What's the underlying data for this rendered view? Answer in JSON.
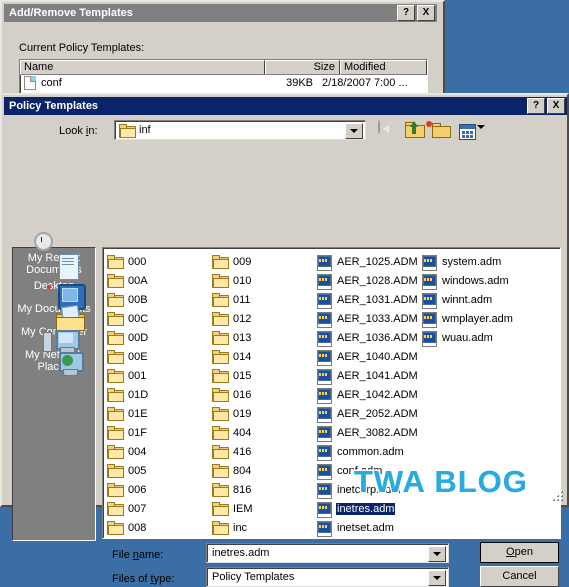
{
  "colors": {
    "desktop_bg": "#3a6ea5",
    "dialog_face": "#d4d0c8",
    "active_title": "#0a246a",
    "inactive_title": "#808080",
    "selection": "#0a246a",
    "watermark": "#29abe2"
  },
  "dialog1": {
    "title": "Add/Remove Templates",
    "help_button": "?",
    "close_button": "X",
    "label": "Current Policy Templates:",
    "columns": [
      "Name",
      "Size",
      "Modified"
    ],
    "rows": [
      {
        "name": "conf",
        "size": "39KB",
        "modified": "2/18/2007 7:00 ..."
      }
    ]
  },
  "dialog2": {
    "title": "Policy Templates",
    "help_button": "?",
    "close_button": "X",
    "lookin": {
      "label": "Look in:",
      "value": "inf"
    },
    "toolbar": [
      {
        "name": "back-icon",
        "label": "Back"
      },
      {
        "name": "up-one-level-icon",
        "label": "Up One Level"
      },
      {
        "name": "new-folder-icon",
        "label": "Create New Folder"
      },
      {
        "name": "views-icon",
        "label": "Views"
      }
    ],
    "places": [
      {
        "label": "My Recent\nDocuments",
        "line1": "My Recent",
        "line2": "Documents",
        "icon": "recent-documents-icon"
      },
      {
        "label": "Desktop",
        "line1": "Desktop",
        "line2": "",
        "icon": "desktop-icon"
      },
      {
        "label": "My Documents",
        "line1": "My Documents",
        "line2": "",
        "icon": "my-documents-icon"
      },
      {
        "label": "My Computer",
        "line1": "My Computer",
        "line2": "",
        "icon": "my-computer-icon"
      },
      {
        "label": "My Network Places",
        "line1": "My Network",
        "line2": "Places",
        "icon": "my-network-places-icon"
      }
    ],
    "file_columns": [
      {
        "items": [
          {
            "name": "000",
            "type": "folder"
          },
          {
            "name": "00A",
            "type": "folder"
          },
          {
            "name": "00B",
            "type": "folder"
          },
          {
            "name": "00C",
            "type": "folder"
          },
          {
            "name": "00D",
            "type": "folder"
          },
          {
            "name": "00E",
            "type": "folder"
          },
          {
            "name": "001",
            "type": "folder"
          },
          {
            "name": "01D",
            "type": "folder"
          },
          {
            "name": "01E",
            "type": "folder"
          },
          {
            "name": "01F",
            "type": "folder"
          },
          {
            "name": "004",
            "type": "folder"
          },
          {
            "name": "005",
            "type": "folder"
          },
          {
            "name": "006",
            "type": "folder"
          },
          {
            "name": "007",
            "type": "folder"
          },
          {
            "name": "008",
            "type": "folder"
          }
        ]
      },
      {
        "items": [
          {
            "name": "009",
            "type": "folder"
          },
          {
            "name": "010",
            "type": "folder"
          },
          {
            "name": "011",
            "type": "folder"
          },
          {
            "name": "012",
            "type": "folder"
          },
          {
            "name": "013",
            "type": "folder"
          },
          {
            "name": "014",
            "type": "folder"
          },
          {
            "name": "015",
            "type": "folder"
          },
          {
            "name": "016",
            "type": "folder"
          },
          {
            "name": "019",
            "type": "folder"
          },
          {
            "name": "404",
            "type": "folder"
          },
          {
            "name": "416",
            "type": "folder"
          },
          {
            "name": "804",
            "type": "folder"
          },
          {
            "name": "816",
            "type": "folder"
          },
          {
            "name": "IEM",
            "type": "folder"
          },
          {
            "name": "inc",
            "type": "folder"
          }
        ]
      },
      {
        "items": [
          {
            "name": "AER_1025.ADM",
            "type": "adm"
          },
          {
            "name": "AER_1028.ADM",
            "type": "adm"
          },
          {
            "name": "AER_1031.ADM",
            "type": "adm"
          },
          {
            "name": "AER_1033.ADM",
            "type": "adm"
          },
          {
            "name": "AER_1036.ADM",
            "type": "adm"
          },
          {
            "name": "AER_1040.ADM",
            "type": "adm"
          },
          {
            "name": "AER_1041.ADM",
            "type": "adm"
          },
          {
            "name": "AER_1042.ADM",
            "type": "adm"
          },
          {
            "name": "AER_2052.ADM",
            "type": "adm"
          },
          {
            "name": "AER_3082.ADM",
            "type": "adm"
          },
          {
            "name": "common.adm",
            "type": "adm"
          },
          {
            "name": "conf.adm",
            "type": "adm"
          },
          {
            "name": "inetcorp.adm",
            "type": "adm"
          },
          {
            "name": "inetres.adm",
            "type": "adm",
            "selected": true
          },
          {
            "name": "inetset.adm",
            "type": "adm"
          }
        ]
      },
      {
        "items": [
          {
            "name": "system.adm",
            "type": "adm"
          },
          {
            "name": "windows.adm",
            "type": "adm"
          },
          {
            "name": "winnt.adm",
            "type": "adm"
          },
          {
            "name": "wmplayer.adm",
            "type": "adm"
          },
          {
            "name": "wuau.adm",
            "type": "adm"
          }
        ]
      }
    ],
    "filename": {
      "label": "File name:",
      "value": "inetres.adm"
    },
    "filetype": {
      "label": "Files of type:",
      "value": "Policy Templates"
    },
    "open_button": "Open",
    "cancel_button": "Cancel"
  },
  "watermark": {
    "text": "TWA BLOG"
  }
}
